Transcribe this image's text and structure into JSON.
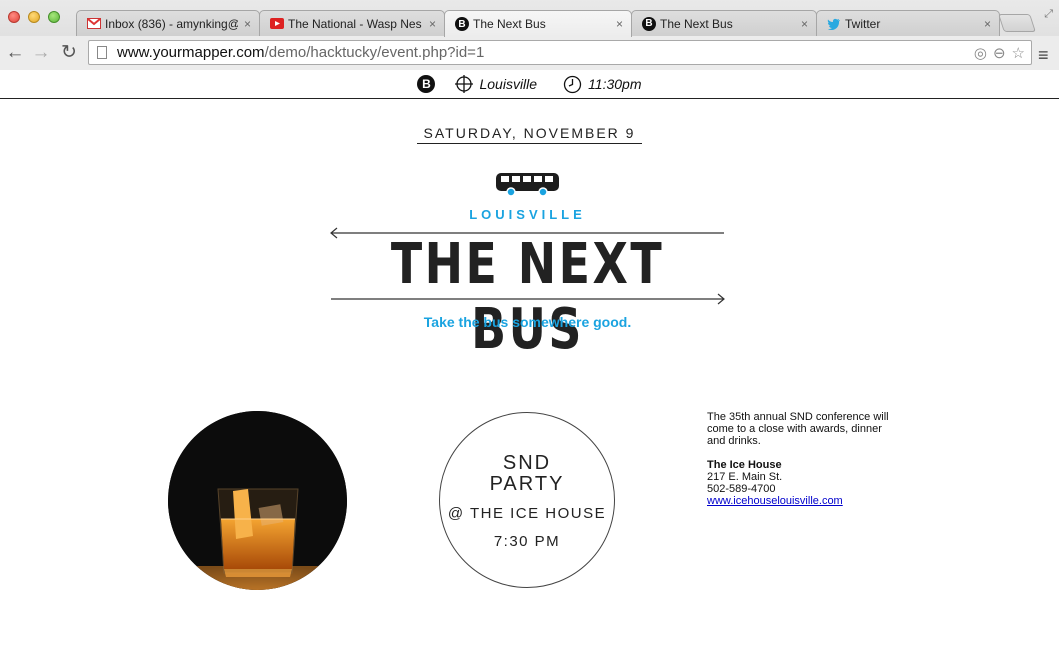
{
  "browser": {
    "tabs": [
      {
        "title": "Inbox (836) - amynking@",
        "favicon": "gmail-icon",
        "active": false
      },
      {
        "title": "The National - Wasp Nes",
        "favicon": "youtube-icon",
        "active": false
      },
      {
        "title": "The Next Bus",
        "favicon": "nextbus-b-icon",
        "active": true
      },
      {
        "title": "The Next Bus",
        "favicon": "nextbus-b-icon",
        "active": false
      },
      {
        "title": "Twitter",
        "favicon": "twitter-icon",
        "active": false
      }
    ],
    "close_glyph": "×",
    "url_host": "www.yourmapper.com",
    "url_path": "/demo/hacktucky/event.php?id=1"
  },
  "sitebar": {
    "logo_letter": "B",
    "location": "Louisville",
    "time": "11:30pm"
  },
  "event": {
    "date": "SATURDAY, NOVEMBER 9",
    "city": "LOUISVILLE",
    "logo_title": "THE NEXT BUS",
    "tagline": "Take the bus somewhere good.",
    "party_title": "SND\nPARTY",
    "party_venue": "@ THE ICE HOUSE",
    "party_time": "7:30 PM",
    "description": "The 35th annual SND conference will come to a close with awards, dinner and drinks.",
    "venue_name": "The Ice House",
    "address": "217 E. Main St.",
    "phone": "502-589-4700",
    "website": "www.icehouselouisville.com"
  },
  "colors": {
    "accent": "#1aa3e0",
    "text": "#222222"
  }
}
